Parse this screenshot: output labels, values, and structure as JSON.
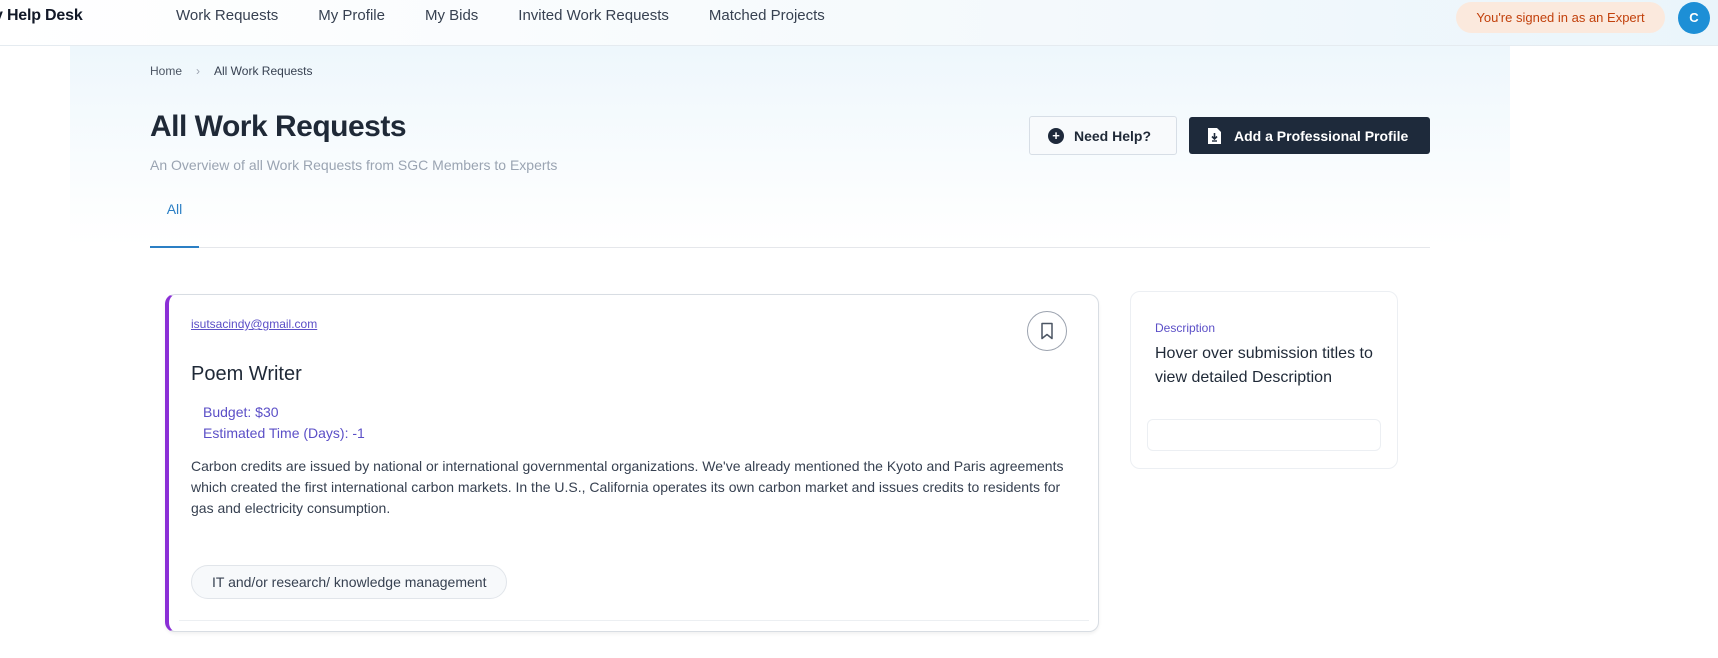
{
  "header": {
    "brand": "y Help Desk",
    "nav": [
      "Work Requests",
      "My Profile",
      "My Bids",
      "Invited Work Requests",
      "Matched Projects"
    ],
    "signed_in_badge": "You're signed in as an Expert",
    "avatar_initial": "C"
  },
  "breadcrumb": {
    "home": "Home",
    "separator": "›",
    "current": "All Work Requests"
  },
  "page": {
    "title": "All Work Requests",
    "subtitle": "An Overview of all Work Requests from SGC Members to Experts",
    "help_button": "Need Help?",
    "add_button": "Add a Professional Profile"
  },
  "tabs": {
    "all": "All"
  },
  "card": {
    "email": "isutsacindy@gmail.com",
    "title": "Poem Writer",
    "budget": "Budget: $30",
    "estimated_time": "Estimated Time (Days): -1",
    "description": "Carbon credits are issued by national or international governmental organizations. We've already mentioned the Kyoto and Paris agreements which created the first international carbon markets. In the U.S., California operates its own carbon market and issues credits to residents for gas and electricity consumption.",
    "tag": "IT and/or research/ knowledge management",
    "accent_color": "#8b2fd6"
  },
  "side_panel": {
    "label": "Description",
    "text": "Hover over submission titles to view detailed Description"
  },
  "colors": {
    "primary_dark": "#1e2a3b",
    "link_purple": "#5b4fc7",
    "tab_blue": "#2b7fc4",
    "badge_bg": "#fbe9dd",
    "badge_text": "#c2410c",
    "avatar_bg": "#1d8fd6"
  }
}
